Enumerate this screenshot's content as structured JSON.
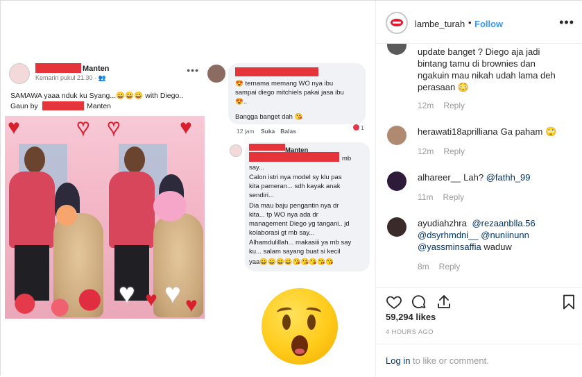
{
  "post": {
    "fb_name_suffix": "Manten",
    "fb_time": "Kemarin pukul 21.30 · ",
    "fb_dots": "•••",
    "fb_caption_line1": "SAMAWA yaaa nduk ku Syang...😀😀😀 with Diego..",
    "fb_caption_line2": "Gaun by",
    "fb_caption_line2_suffix": "Manten",
    "comment1": {
      "line1": "😍 ternama memang WO nya ibu",
      "line2": "sampai diego mitchiels pakai jasa ibu",
      "line3": "😍..",
      "line4": "Bangga banget dah 😘",
      "time": "12 jam",
      "like": "Suka",
      "reply": "Balas",
      "reaction_count": "1"
    },
    "comment2": {
      "name_suffix": "Manten",
      "mb": "mb",
      "lines": [
        "say...",
        "Calon istri nya model sy klu pas",
        "kita pameran... sdh kayak anak",
        "sendiri...",
        "Dia mau baju pengantin nya dr",
        "kita... tp WO nya ada dr",
        "management Diego yg tangani.. jd",
        "kolaborasi gt mb say...",
        "Alhamdulillah... makasiii ya mb say",
        "ku... salam sayang buat si kecil",
        "yaa😀😀😀😀😘😘😘😘😘"
      ]
    }
  },
  "sidebar": {
    "username": "lambe_turah",
    "separator": "•",
    "follow_label": "Follow",
    "menu_dots": "•••",
    "comments": [
      {
        "user": "",
        "text_lines": [
          "update banget ? Diego aja jadi",
          "bintang tamu di brownies dan",
          "ngakuin mau nikah udah lama deh",
          "perasaan 😳"
        ],
        "time": "12m",
        "reply": "Reply"
      },
      {
        "user": "herawati18aprilliana",
        "text": "Ga paham 🙄",
        "time": "12m",
        "reply": "Reply"
      },
      {
        "user": "alhareer__",
        "text": "Lah?",
        "mention": "@fathh_99",
        "time": "11m",
        "reply": "Reply"
      },
      {
        "user": "ayudiahzhra",
        "mentions_line1": "@rezaanblla.56",
        "mentions_line2a": "@dsyrhmdni__",
        "mentions_line2b": "@nuniinunn",
        "mentions_line3": "@yassminsaffia",
        "text_end": "waduw",
        "time": "8m",
        "reply": "Reply"
      }
    ],
    "likes": "59,294 likes",
    "posted_ago": "4 HOURS AGO",
    "login_link": "Log in",
    "login_rest": " to like or comment."
  },
  "colors": {
    "link": "#003569",
    "follow": "#3897f0",
    "redaction": "#e5353b"
  },
  "icons": [
    "heart-icon",
    "comment-icon",
    "share-icon",
    "bookmark-icon"
  ]
}
